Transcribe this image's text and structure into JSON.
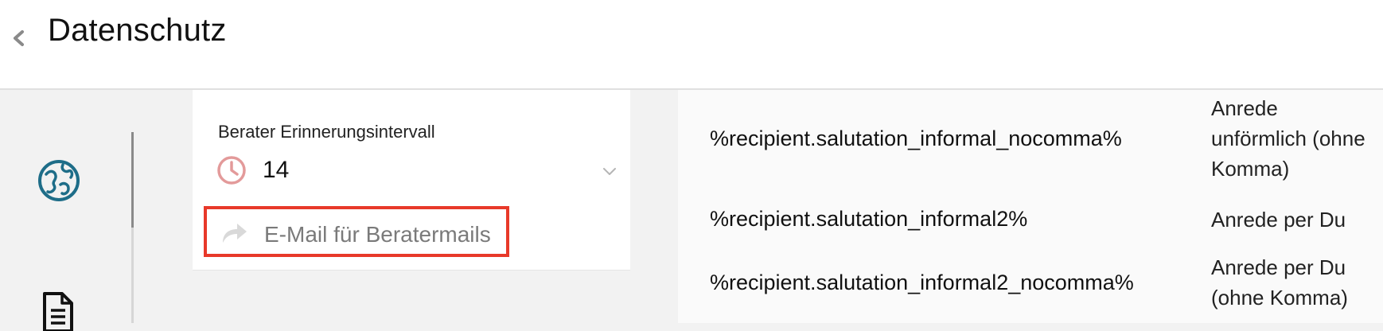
{
  "header": {
    "title": "Datenschutz"
  },
  "settings": {
    "interval_label": "Berater Erinnerungsintervall",
    "interval_value": "14",
    "email_placeholder": "E-Mail für Beratermails"
  },
  "table": {
    "rows": [
      {
        "variable": "%recipient.salutation_informal_nocomma%",
        "description": [
          "Anrede",
          "unförmlich (ohne",
          "Komma)"
        ]
      },
      {
        "variable": "%recipient.salutation_informal2%",
        "description": [
          "Anrede per Du"
        ]
      },
      {
        "variable": "%recipient.salutation_informal2_nocomma%",
        "description": [
          "Anrede per Du",
          "(ohne Komma)"
        ]
      }
    ]
  },
  "icons": {
    "back": "chevron-left-icon",
    "globe": "globe-icon",
    "document": "document-icon",
    "clock": "clock-icon",
    "dropdown": "chevron-down-icon",
    "share": "share-arrow-icon"
  },
  "colors": {
    "globe": "#1e6d88",
    "clock": "#e39a9a",
    "highlight_border": "#e8392a"
  }
}
